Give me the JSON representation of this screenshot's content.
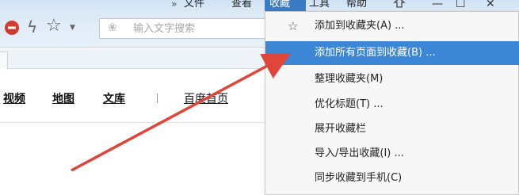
{
  "menubar": {
    "overflow": "»",
    "file": "文件",
    "view": "查看",
    "favorites": "收藏",
    "tools": "工具",
    "help": "帮助"
  },
  "window_controls": {
    "feedback_icon": "feedback-icon",
    "minimize": "—",
    "maximize": "☐",
    "close": "✕"
  },
  "toolbar": {
    "search_placeholder": "输入文字搜索"
  },
  "page": {
    "nav": [
      "视频",
      "地图",
      "文库",
      "百度首页"
    ]
  },
  "favorites_menu": {
    "items": [
      "添加到收藏夹(A) ...",
      "添加所有页面到收藏(B) ...",
      "整理收藏夹(M)",
      "优化标题(T) ...",
      "展开收藏栏",
      "导入/导出收藏(I) ...",
      "同步收藏到手机(C)"
    ],
    "highlighted_index": 1
  },
  "colors": {
    "menu_highlight": "#3c86d6",
    "arrow": "#e0453a",
    "toolbar": "#dbe9f6"
  }
}
